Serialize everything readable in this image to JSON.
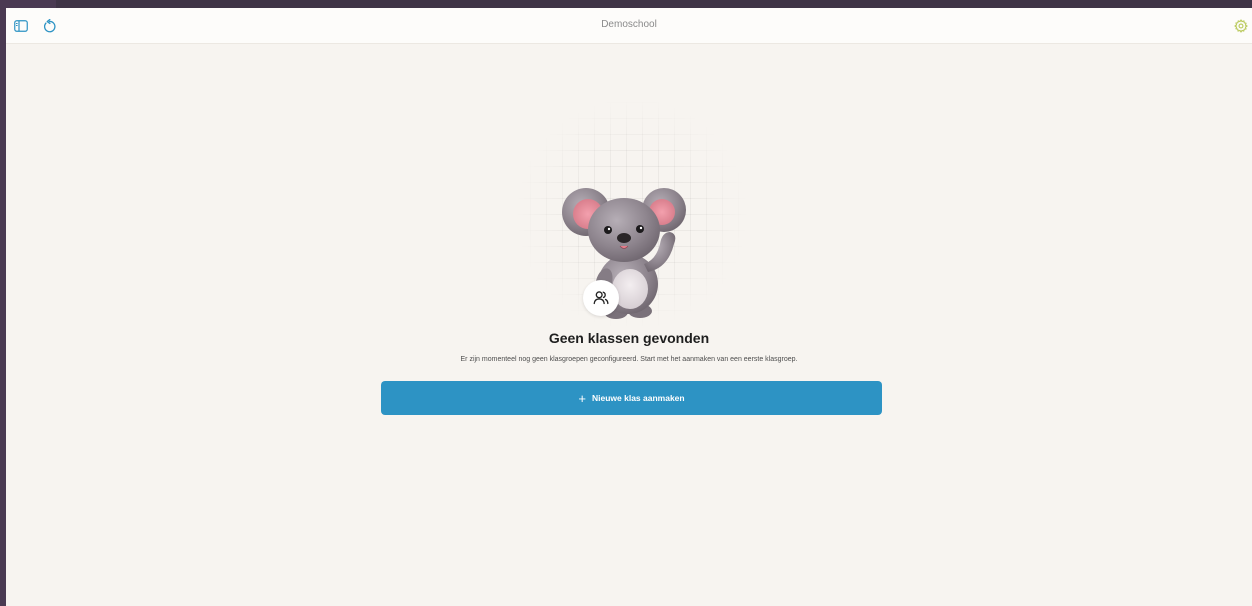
{
  "header": {
    "title": "Demoschool",
    "icons": {
      "sidebar": "sidebar-toggle-icon",
      "refresh": "refresh-icon",
      "settings": "settings-icon"
    },
    "accent": "#2d93c4",
    "settings_color": "#b9c95a"
  },
  "empty_state": {
    "title": "Geen klassen gevonden",
    "description": "Er zijn momenteel nog geen klasgroepen geconfigureerd. Start met het aanmaken van een eerste klasgroep.",
    "badge_icon": "users-icon",
    "illustration": "koala-illustration",
    "button": {
      "label": "Nieuwe klas aanmaken",
      "icon": "plus-icon",
      "color": "#2d93c4"
    }
  }
}
